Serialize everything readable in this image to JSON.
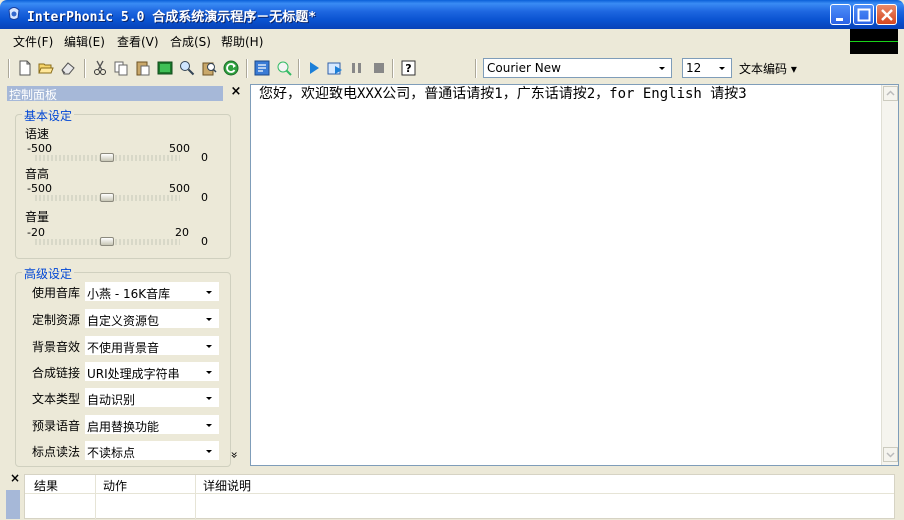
{
  "window": {
    "title": "InterPhonic 5.0 合成系统演示程序－无标题*"
  },
  "menu": [
    {
      "label": "文件(F)"
    },
    {
      "label": "编辑(E)"
    },
    {
      "label": "查看(V)"
    },
    {
      "label": "合成(S)"
    },
    {
      "label": "帮助(H)"
    }
  ],
  "toolbar": {
    "font_name": "Courier New",
    "font_size": "12",
    "encoding_label": "文本编码 ▾",
    "icons": [
      "new-file-icon",
      "open-folder-icon",
      "eraser-icon",
      "cut-icon",
      "copy-icon",
      "paste-icon",
      "select-all-icon",
      "find-icon",
      "replace-icon",
      "refresh-icon",
      "voice-library-icon",
      "zoom-icon",
      "play-icon",
      "synthesize-to-file-icon",
      "pause-icon",
      "stop-icon",
      "help-icon"
    ]
  },
  "panel": {
    "title": "控制面板",
    "close": "×",
    "basic": {
      "title": "基本设定",
      "sliders": [
        {
          "label": "语速",
          "min": "-500",
          "max": "500",
          "value": "0"
        },
        {
          "label": "音高",
          "min": "-500",
          "max": "500",
          "value": "0"
        },
        {
          "label": "音量",
          "min": "-20",
          "max": "20",
          "value": "0"
        }
      ]
    },
    "advanced": {
      "title": "高级设定",
      "rows": [
        {
          "label": "使用音库",
          "value": "小燕 - 16K音库"
        },
        {
          "label": "定制资源",
          "value": "自定义资源包"
        },
        {
          "label": "背景音效",
          "value": "不使用背景音"
        },
        {
          "label": "合成链接",
          "value": "URI处理成字符串"
        },
        {
          "label": "文本类型",
          "value": "自动识别"
        },
        {
          "label": "预录语音",
          "value": "启用替换功能"
        },
        {
          "label": "标点读法",
          "value": "不读标点"
        }
      ],
      "more": "»"
    }
  },
  "editor": {
    "text": "您好，欢迎致电XXX公司，普通话请按1，广东话请按2，for English 请按3"
  },
  "log": {
    "close": "×",
    "columns": [
      "结果",
      "动作",
      "详细说明"
    ]
  },
  "colors": {
    "titlebar": "#0a5fd8",
    "panel_header": "#a6b8d8",
    "group_title": "#0046d5",
    "window_bg": "#ece9d8"
  }
}
